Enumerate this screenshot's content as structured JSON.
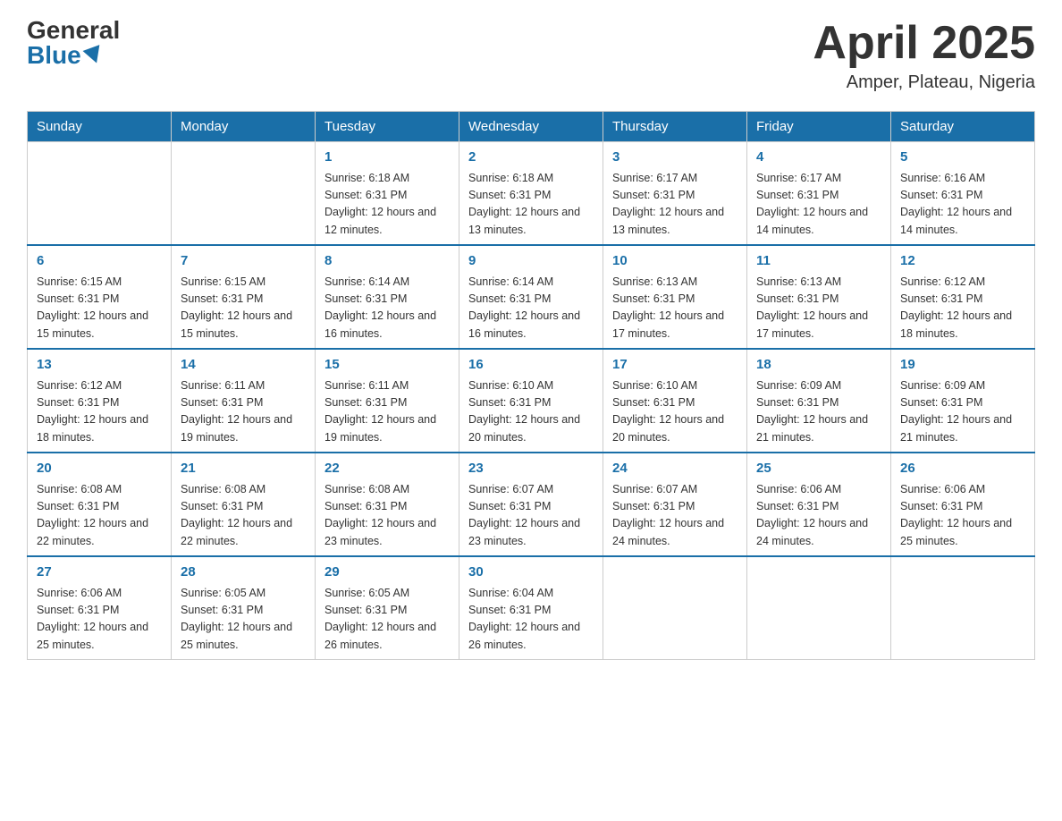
{
  "header": {
    "logo_general": "General",
    "logo_blue": "Blue",
    "month_year": "April 2025",
    "location": "Amper, Plateau, Nigeria"
  },
  "days_of_week": [
    "Sunday",
    "Monday",
    "Tuesday",
    "Wednesday",
    "Thursday",
    "Friday",
    "Saturday"
  ],
  "weeks": [
    [
      {
        "day": "",
        "sunrise": "",
        "sunset": "",
        "daylight": ""
      },
      {
        "day": "",
        "sunrise": "",
        "sunset": "",
        "daylight": ""
      },
      {
        "day": "1",
        "sunrise": "Sunrise: 6:18 AM",
        "sunset": "Sunset: 6:31 PM",
        "daylight": "Daylight: 12 hours and 12 minutes."
      },
      {
        "day": "2",
        "sunrise": "Sunrise: 6:18 AM",
        "sunset": "Sunset: 6:31 PM",
        "daylight": "Daylight: 12 hours and 13 minutes."
      },
      {
        "day": "3",
        "sunrise": "Sunrise: 6:17 AM",
        "sunset": "Sunset: 6:31 PM",
        "daylight": "Daylight: 12 hours and 13 minutes."
      },
      {
        "day": "4",
        "sunrise": "Sunrise: 6:17 AM",
        "sunset": "Sunset: 6:31 PM",
        "daylight": "Daylight: 12 hours and 14 minutes."
      },
      {
        "day": "5",
        "sunrise": "Sunrise: 6:16 AM",
        "sunset": "Sunset: 6:31 PM",
        "daylight": "Daylight: 12 hours and 14 minutes."
      }
    ],
    [
      {
        "day": "6",
        "sunrise": "Sunrise: 6:15 AM",
        "sunset": "Sunset: 6:31 PM",
        "daylight": "Daylight: 12 hours and 15 minutes."
      },
      {
        "day": "7",
        "sunrise": "Sunrise: 6:15 AM",
        "sunset": "Sunset: 6:31 PM",
        "daylight": "Daylight: 12 hours and 15 minutes."
      },
      {
        "day": "8",
        "sunrise": "Sunrise: 6:14 AM",
        "sunset": "Sunset: 6:31 PM",
        "daylight": "Daylight: 12 hours and 16 minutes."
      },
      {
        "day": "9",
        "sunrise": "Sunrise: 6:14 AM",
        "sunset": "Sunset: 6:31 PM",
        "daylight": "Daylight: 12 hours and 16 minutes."
      },
      {
        "day": "10",
        "sunrise": "Sunrise: 6:13 AM",
        "sunset": "Sunset: 6:31 PM",
        "daylight": "Daylight: 12 hours and 17 minutes."
      },
      {
        "day": "11",
        "sunrise": "Sunrise: 6:13 AM",
        "sunset": "Sunset: 6:31 PM",
        "daylight": "Daylight: 12 hours and 17 minutes."
      },
      {
        "day": "12",
        "sunrise": "Sunrise: 6:12 AM",
        "sunset": "Sunset: 6:31 PM",
        "daylight": "Daylight: 12 hours and 18 minutes."
      }
    ],
    [
      {
        "day": "13",
        "sunrise": "Sunrise: 6:12 AM",
        "sunset": "Sunset: 6:31 PM",
        "daylight": "Daylight: 12 hours and 18 minutes."
      },
      {
        "day": "14",
        "sunrise": "Sunrise: 6:11 AM",
        "sunset": "Sunset: 6:31 PM",
        "daylight": "Daylight: 12 hours and 19 minutes."
      },
      {
        "day": "15",
        "sunrise": "Sunrise: 6:11 AM",
        "sunset": "Sunset: 6:31 PM",
        "daylight": "Daylight: 12 hours and 19 minutes."
      },
      {
        "day": "16",
        "sunrise": "Sunrise: 6:10 AM",
        "sunset": "Sunset: 6:31 PM",
        "daylight": "Daylight: 12 hours and 20 minutes."
      },
      {
        "day": "17",
        "sunrise": "Sunrise: 6:10 AM",
        "sunset": "Sunset: 6:31 PM",
        "daylight": "Daylight: 12 hours and 20 minutes."
      },
      {
        "day": "18",
        "sunrise": "Sunrise: 6:09 AM",
        "sunset": "Sunset: 6:31 PM",
        "daylight": "Daylight: 12 hours and 21 minutes."
      },
      {
        "day": "19",
        "sunrise": "Sunrise: 6:09 AM",
        "sunset": "Sunset: 6:31 PM",
        "daylight": "Daylight: 12 hours and 21 minutes."
      }
    ],
    [
      {
        "day": "20",
        "sunrise": "Sunrise: 6:08 AM",
        "sunset": "Sunset: 6:31 PM",
        "daylight": "Daylight: 12 hours and 22 minutes."
      },
      {
        "day": "21",
        "sunrise": "Sunrise: 6:08 AM",
        "sunset": "Sunset: 6:31 PM",
        "daylight": "Daylight: 12 hours and 22 minutes."
      },
      {
        "day": "22",
        "sunrise": "Sunrise: 6:08 AM",
        "sunset": "Sunset: 6:31 PM",
        "daylight": "Daylight: 12 hours and 23 minutes."
      },
      {
        "day": "23",
        "sunrise": "Sunrise: 6:07 AM",
        "sunset": "Sunset: 6:31 PM",
        "daylight": "Daylight: 12 hours and 23 minutes."
      },
      {
        "day": "24",
        "sunrise": "Sunrise: 6:07 AM",
        "sunset": "Sunset: 6:31 PM",
        "daylight": "Daylight: 12 hours and 24 minutes."
      },
      {
        "day": "25",
        "sunrise": "Sunrise: 6:06 AM",
        "sunset": "Sunset: 6:31 PM",
        "daylight": "Daylight: 12 hours and 24 minutes."
      },
      {
        "day": "26",
        "sunrise": "Sunrise: 6:06 AM",
        "sunset": "Sunset: 6:31 PM",
        "daylight": "Daylight: 12 hours and 25 minutes."
      }
    ],
    [
      {
        "day": "27",
        "sunrise": "Sunrise: 6:06 AM",
        "sunset": "Sunset: 6:31 PM",
        "daylight": "Daylight: 12 hours and 25 minutes."
      },
      {
        "day": "28",
        "sunrise": "Sunrise: 6:05 AM",
        "sunset": "Sunset: 6:31 PM",
        "daylight": "Daylight: 12 hours and 25 minutes."
      },
      {
        "day": "29",
        "sunrise": "Sunrise: 6:05 AM",
        "sunset": "Sunset: 6:31 PM",
        "daylight": "Daylight: 12 hours and 26 minutes."
      },
      {
        "day": "30",
        "sunrise": "Sunrise: 6:04 AM",
        "sunset": "Sunset: 6:31 PM",
        "daylight": "Daylight: 12 hours and 26 minutes."
      },
      {
        "day": "",
        "sunrise": "",
        "sunset": "",
        "daylight": ""
      },
      {
        "day": "",
        "sunrise": "",
        "sunset": "",
        "daylight": ""
      },
      {
        "day": "",
        "sunrise": "",
        "sunset": "",
        "daylight": ""
      }
    ]
  ]
}
